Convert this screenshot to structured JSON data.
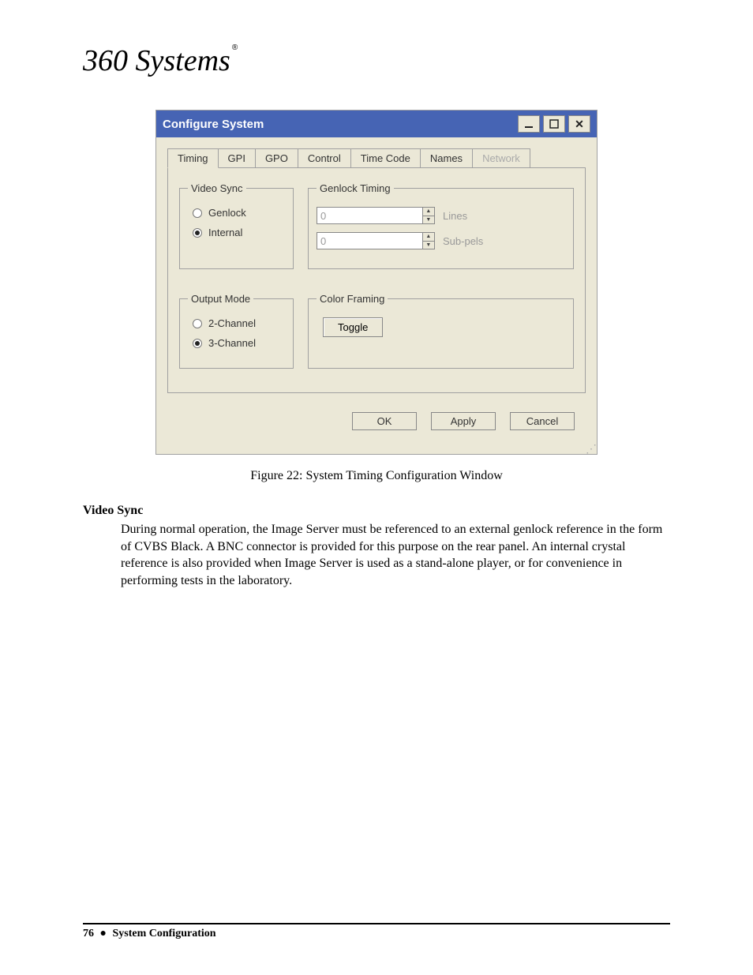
{
  "logo_text": "360 Systems",
  "window": {
    "title": "Configure System",
    "tabs": [
      "Timing",
      "GPI",
      "GPO",
      "Control",
      "Time Code",
      "Names",
      "Network"
    ],
    "active_tab_index": 0,
    "disabled_tab_indices": [
      6
    ],
    "video_sync": {
      "legend": "Video Sync",
      "options": [
        "Genlock",
        "Internal"
      ],
      "selected_index": 1
    },
    "genlock_timing": {
      "legend": "Genlock Timing",
      "lines_value": "0",
      "lines_label": "Lines",
      "subpels_value": "0",
      "subpels_label": "Sub-pels"
    },
    "output_mode": {
      "legend": "Output Mode",
      "options": [
        "2-Channel",
        "3-Channel"
      ],
      "selected_index": 1
    },
    "color_framing": {
      "legend": "Color Framing",
      "toggle_label": "Toggle"
    },
    "buttons": {
      "ok": "OK",
      "apply": "Apply",
      "cancel": "Cancel"
    }
  },
  "figure_caption": "Figure 22:  System Timing Configuration Window",
  "section_heading": "Video Sync",
  "body_text": "During normal operation, the Image Server must be referenced to an external genlock reference in the form of CVBS Black.  A BNC connector is provided for this purpose on the rear panel.  An internal crystal reference is also provided when Image Server is used as a stand-alone player, or for convenience in performing tests in the laboratory.",
  "footer": {
    "page_number": "76",
    "bullet": "●",
    "section_name": "System Configuration"
  }
}
